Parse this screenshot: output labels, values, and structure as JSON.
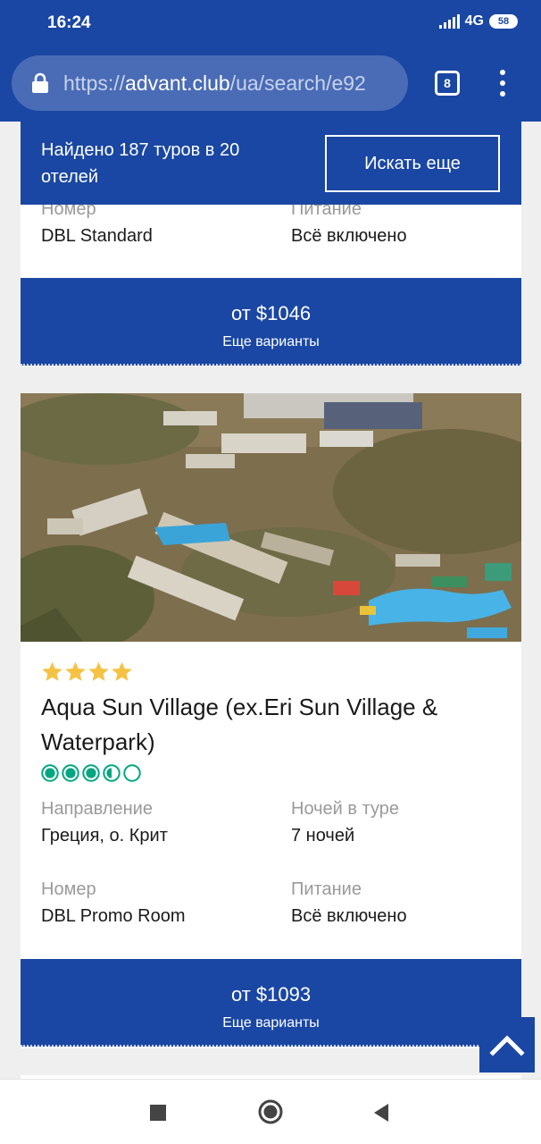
{
  "status_bar": {
    "time": "16:24",
    "network": "4G",
    "battery": "58"
  },
  "browser": {
    "url_scheme": "https://",
    "url_domain": "advant.club",
    "url_path": "/ua/search/e92",
    "tab_count": "8"
  },
  "search_summary": {
    "found_text": "Найдено 187 туров в 20 отелей",
    "search_more_label": "Искать еще"
  },
  "prev_card": {
    "room_label": "Номер",
    "room_value": "DBL Standard",
    "meal_label": "Питание",
    "meal_value": "Всё включено",
    "price": "от $1046",
    "more_options": "Еще варианты"
  },
  "hotel_card": {
    "stars": 4,
    "name": "Aqua Sun Village (ex.Eri Sun Village & Waterpark)",
    "tripadvisor_rating": 3.5,
    "direction_label": "Направление",
    "direction_value": "Греция, о. Крит",
    "nights_label": "Ночей в туре",
    "nights_value": "7 ночей",
    "room_label": "Номер",
    "room_value": "DBL Promo Room",
    "meal_label": "Питание",
    "meal_value": "Всё включено",
    "price": "от $1093",
    "more_options": "Еще варианты"
  },
  "colors": {
    "brand_blue": "#1a47a3",
    "star_yellow": "#f6c244",
    "rating_green": "#00a680"
  },
  "icons": {
    "lock": "lock-icon",
    "menu": "more-vert-icon",
    "scroll_top": "chevron-up-icon",
    "nav_recents": "square-icon",
    "nav_home": "circle-icon",
    "nav_back": "triangle-back-icon"
  }
}
